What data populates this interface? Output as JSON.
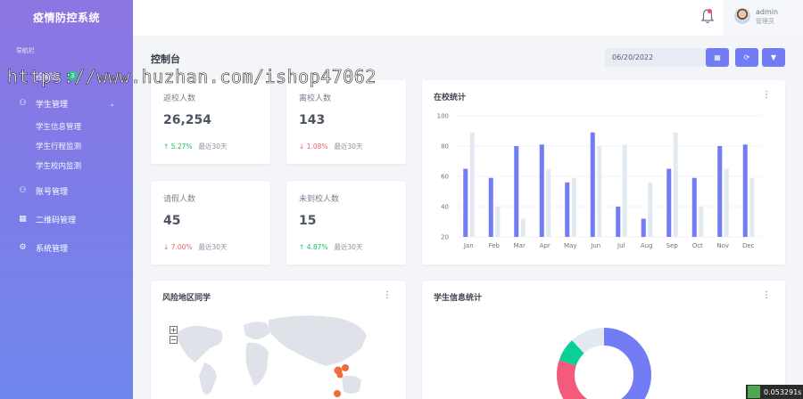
{
  "app": {
    "title": "疫情防控系统"
  },
  "sidebar": {
    "caption": "导航栏",
    "items": [
      {
        "label": "控制台",
        "icon": "dashboard-icon",
        "glyph": "◠",
        "badge": "3"
      },
      {
        "label": "学生管理",
        "icon": "student-icon",
        "glyph": "⚇"
      },
      {
        "label": "账号管理",
        "icon": "account-icon",
        "glyph": "⚇"
      },
      {
        "label": "二维码管理",
        "icon": "qrcode-icon",
        "glyph": "▦"
      },
      {
        "label": "系统管理",
        "icon": "settings-icon",
        "glyph": "⚙"
      }
    ],
    "sub_items": [
      "学生信息管理",
      "学生行程监测",
      "学生校内监测"
    ]
  },
  "topbar": {
    "user_name": "admin",
    "user_role": "管理员"
  },
  "page": {
    "title": "控制台",
    "date_value": "06/20/2022",
    "buttons": {
      "calendar": "▦",
      "refresh": "⟳",
      "filter": "▼"
    }
  },
  "stats": [
    {
      "label": "返校人数",
      "value": "26,254",
      "change": "5.27%",
      "direction": "up",
      "arrow": "↑",
      "period": "最近30天"
    },
    {
      "label": "离校人数",
      "value": "143",
      "change": "1.08%",
      "direction": "down",
      "arrow": "↓",
      "period": "最近30天"
    },
    {
      "label": "请假人数",
      "value": "45",
      "change": "7.00%",
      "direction": "down",
      "arrow": "↓",
      "period": "最近30天"
    },
    {
      "label": "未到校人数",
      "value": "15",
      "change": "4.87%",
      "direction": "up",
      "arrow": "↑",
      "period": "最近30天"
    }
  ],
  "cards": {
    "bar_title": "在校统计",
    "map_title": "风险地区同学",
    "donut_title": "学生信息统计",
    "more_glyph": "⋮",
    "zoom_in": "+",
    "zoom_out": "−"
  },
  "chart_data": {
    "type": "bar",
    "categories": [
      "Jan",
      "Feb",
      "Mar",
      "Apr",
      "May",
      "Jun",
      "Jul",
      "Aug",
      "Sep",
      "Oct",
      "Nov",
      "Dec"
    ],
    "series": [
      {
        "values": [
          65,
          59,
          80,
          81,
          56,
          89,
          40,
          32,
          65,
          59,
          80,
          81
        ],
        "color": "#727cf5"
      },
      {
        "values": [
          89,
          40,
          32,
          65,
          59,
          80,
          81,
          56,
          89,
          40,
          65,
          59
        ],
        "color": "#e3eaef"
      }
    ],
    "ylim": [
      20,
      100
    ],
    "yticks": [
      20,
      40,
      60,
      80,
      100
    ],
    "grid": true
  },
  "donut": {
    "segments": [
      {
        "value": 50,
        "color": "#727cf5"
      },
      {
        "value": 30,
        "color": "#f35a7b"
      },
      {
        "value": 8,
        "color": "#0acf97"
      },
      {
        "value": 12,
        "color": "#e3eaef"
      }
    ]
  },
  "watermark": "https://www.huzhan.com/ishop47062",
  "timer": "0.053291s",
  "colors": {
    "accent": "#727cf5",
    "success": "#10c469",
    "danger": "#f05a6e"
  }
}
